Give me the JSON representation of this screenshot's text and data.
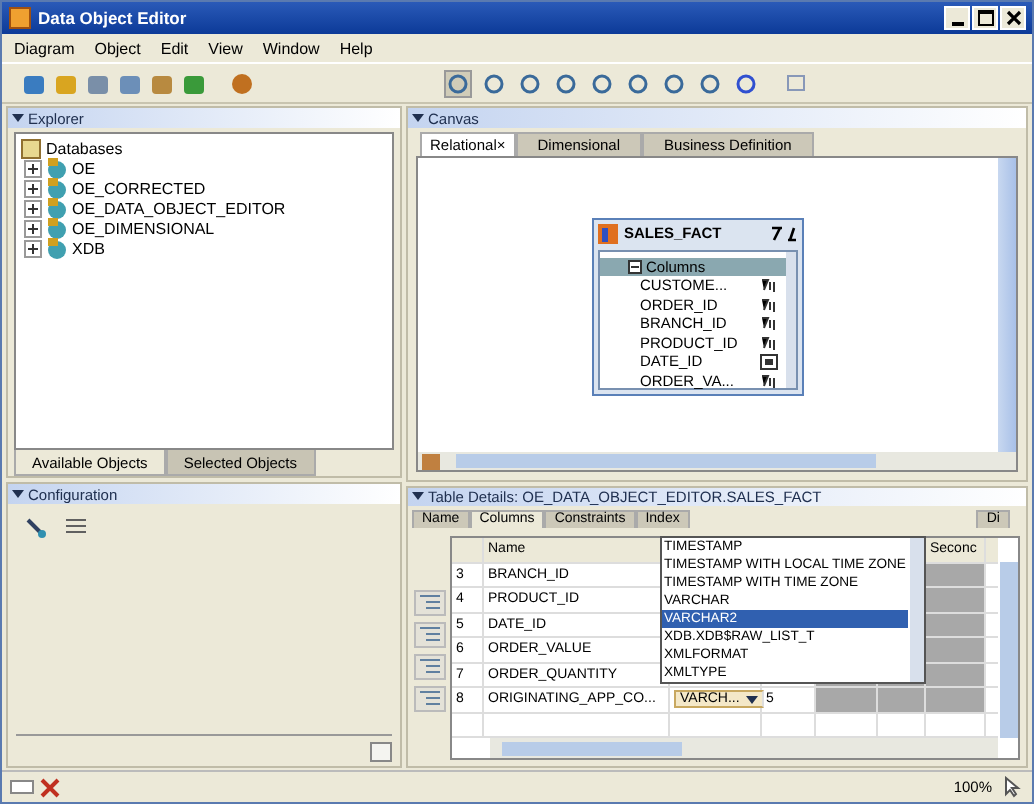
{
  "window": {
    "title": "Data Object Editor"
  },
  "menu": [
    "Diagram",
    "Object",
    "Edit",
    "View",
    "Window",
    "Help"
  ],
  "explorer": {
    "title": "Explorer",
    "root": {
      "label": "Databases",
      "children": [
        {
          "label": "OE",
          "expanded": false
        },
        {
          "label": "OE_CORRECTED",
          "expanded": false
        },
        {
          "label": "OE_DATA_OBJECT_EDITOR",
          "expanded": false
        },
        {
          "label": "OE_DIMENSIONAL",
          "expanded": false
        },
        {
          "label": "XDB",
          "expanded": false
        }
      ]
    },
    "tabs": [
      {
        "label": "Available Objects",
        "selected": true
      },
      {
        "label": "Selected Objects",
        "selected": false
      }
    ]
  },
  "configuration": {
    "title": "Configuration"
  },
  "canvas": {
    "title": "Canvas",
    "tabs": [
      {
        "label": "Relational",
        "close": "×",
        "selected": true
      },
      {
        "label": "Dimensional",
        "selected": false
      },
      {
        "label": "Business Definition",
        "selected": false
      }
    ],
    "table": {
      "name": "SALES_FACT",
      "group": "Columns",
      "columns": [
        {
          "name": "CUSTOME...",
          "kind": "number"
        },
        {
          "name": "ORDER_ID",
          "kind": "number"
        },
        {
          "name": "BRANCH_ID",
          "kind": "number"
        },
        {
          "name": "PRODUCT_ID",
          "kind": "number"
        },
        {
          "name": "DATE_ID",
          "kind": "date"
        },
        {
          "name": "ORDER_VA...",
          "kind": "number"
        }
      ]
    }
  },
  "details": {
    "title": "Table Details: OE_DATA_OBJECT_EDITOR.SALES_FACT",
    "tabs": [
      {
        "label": "Name",
        "selected": false
      },
      {
        "label": "Columns",
        "selected": true
      },
      {
        "label": "Constraints",
        "selected": false
      },
      {
        "label": "Index",
        "selected": false
      },
      {
        "label": "Di",
        "selected": false
      }
    ],
    "headers": [
      "Name",
      "Seconc"
    ],
    "rows": [
      {
        "number": "3",
        "name": "BRANCH_ID"
      },
      {
        "number": "4",
        "name": "PRODUCT_ID"
      },
      {
        "number": "5",
        "name": "DATE_ID"
      },
      {
        "number": "6",
        "name": "ORDER_VALUE"
      },
      {
        "number": "7",
        "name": "ORDER_QUANTITY"
      },
      {
        "number": "8",
        "name": "ORIGINATING_APP_CO...",
        "type": "VARCH...",
        "length": "5"
      }
    ],
    "dropdown": [
      {
        "label": "TIMESTAMP",
        "selected": false
      },
      {
        "label": "TIMESTAMP WITH LOCAL TIME ZONE",
        "selected": false
      },
      {
        "label": "TIMESTAMP WITH TIME ZONE",
        "selected": false
      },
      {
        "label": "VARCHAR",
        "selected": false
      },
      {
        "label": "VARCHAR2",
        "selected": true
      },
      {
        "label": "XDB.XDB$RAW_LIST_T",
        "selected": false
      },
      {
        "label": "XMLFORMAT",
        "selected": false
      },
      {
        "label": "XMLTYPE",
        "selected": false
      }
    ]
  },
  "status_bar": {
    "zoom": "100%"
  }
}
